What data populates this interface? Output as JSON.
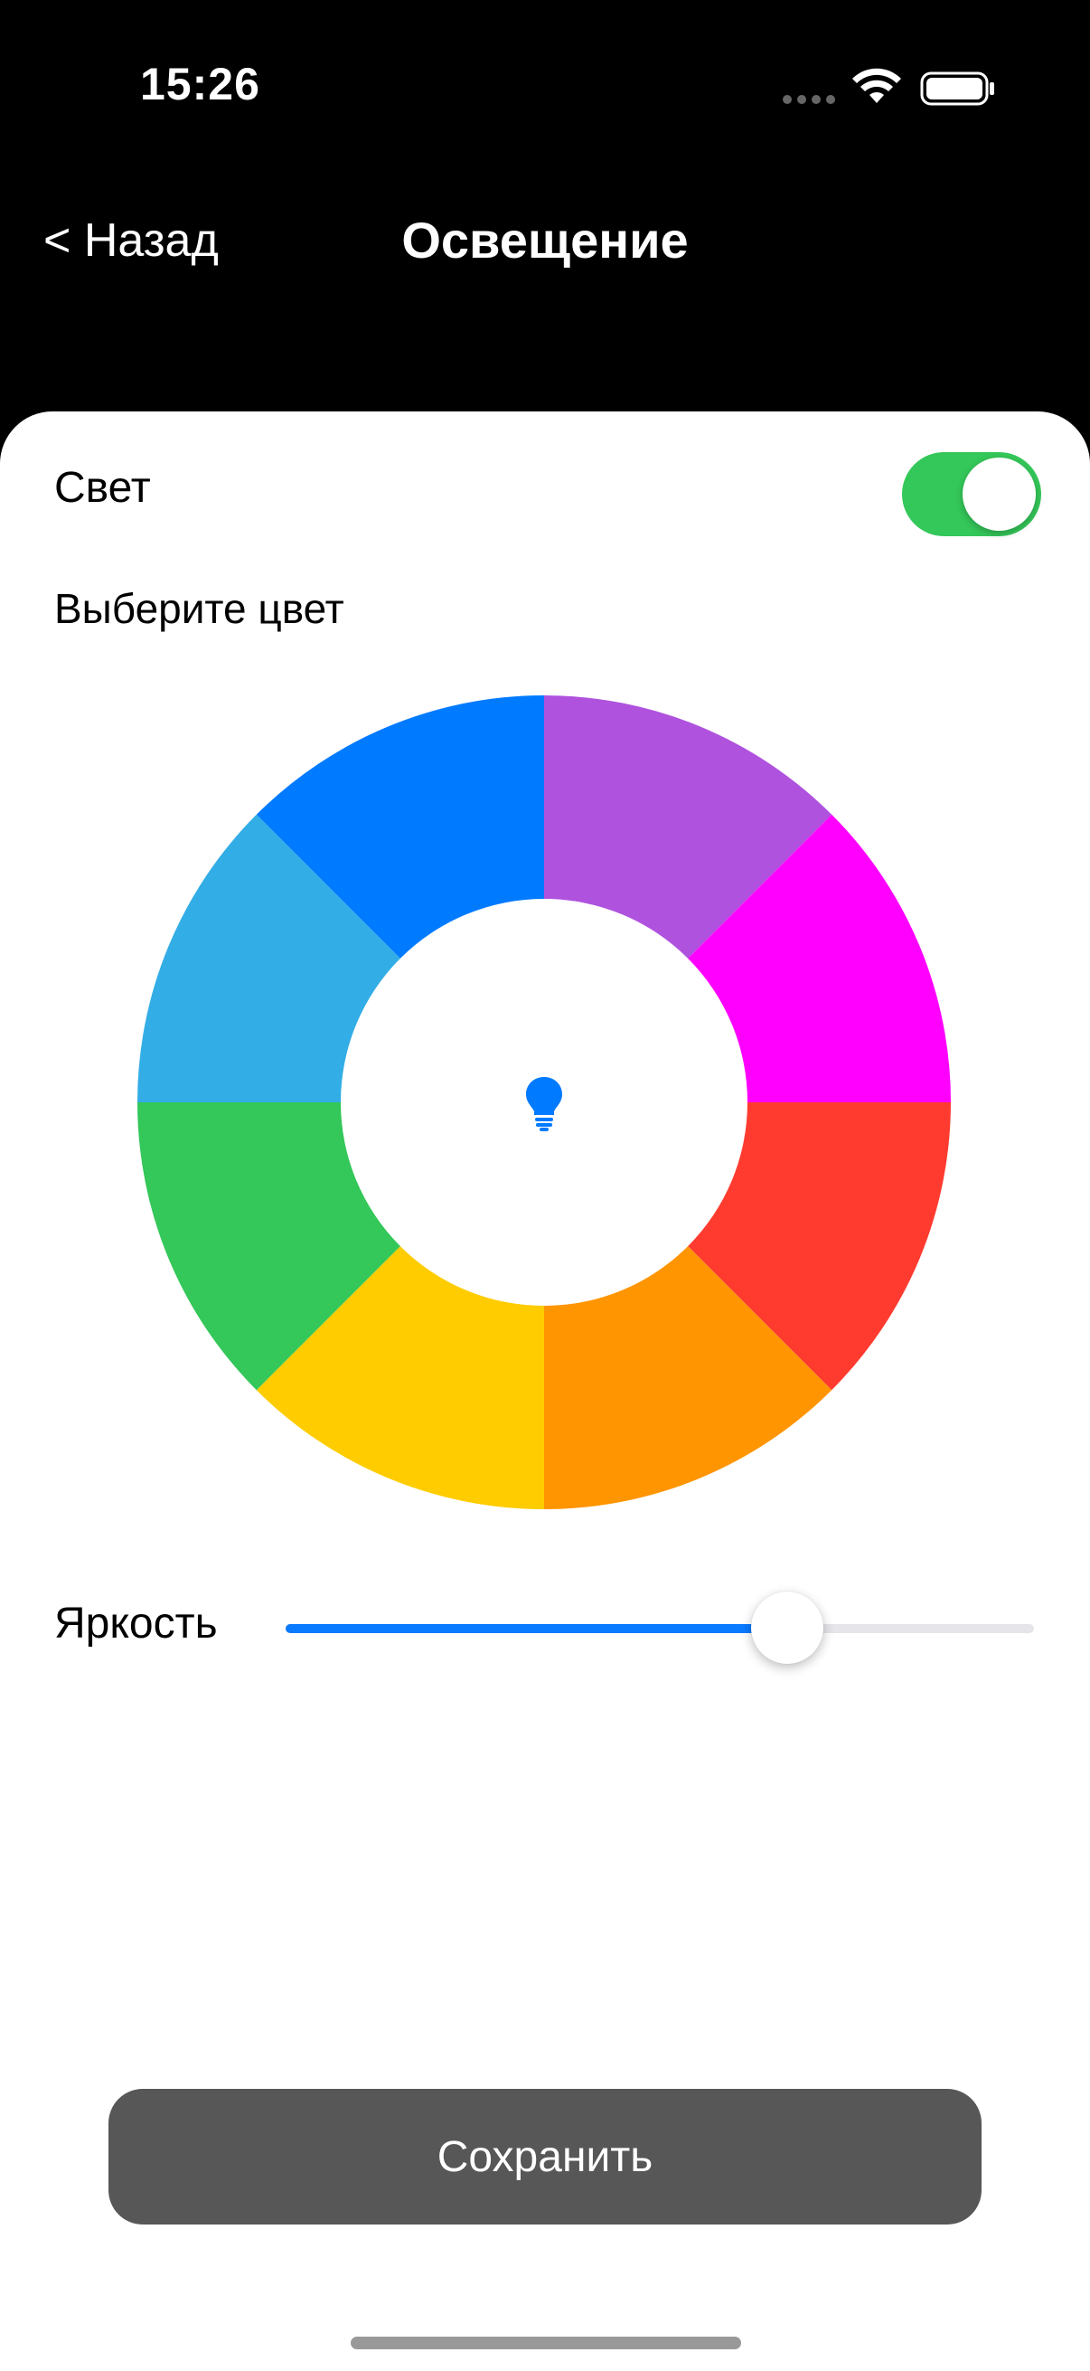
{
  "status_bar": {
    "time": "15:26"
  },
  "nav": {
    "back_label": "< Назад",
    "title": "Освещение"
  },
  "settings": {
    "light_label": "Свет",
    "light_on": true,
    "choose_color_label": "Выберите цвет",
    "brightness_label": "Яркость",
    "brightness_value": 0.67
  },
  "color_wheel": {
    "segments": [
      {
        "name": "purple",
        "color": "#af52de"
      },
      {
        "name": "magenta",
        "color": "#ff00ff"
      },
      {
        "name": "red",
        "color": "#ff3b30"
      },
      {
        "name": "orange",
        "color": "#ff9500"
      },
      {
        "name": "yellow",
        "color": "#ffcc00"
      },
      {
        "name": "green",
        "color": "#34c759"
      },
      {
        "name": "light-blue",
        "color": "#32ade6"
      },
      {
        "name": "blue",
        "color": "#007aff"
      }
    ],
    "center_icon": "lightbulb-icon",
    "icon_color": "#007aff"
  },
  "actions": {
    "save_label": "Сохранить"
  },
  "colors": {
    "toggle_on": "#34c759",
    "slider_fill": "#0a7aff",
    "save_button": "#575757"
  }
}
